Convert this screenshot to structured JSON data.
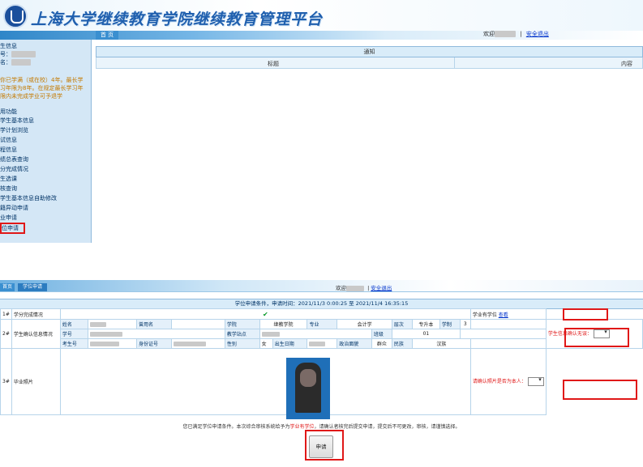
{
  "top": {
    "site_title": "上海大学继续教育学院继续教育管理平台",
    "home_tab": "首 页",
    "welcome": "欢迎",
    "separator": "|",
    "logout": "安全退出",
    "sidebar": {
      "student_info_header": "生信息",
      "student_no_label": "号：",
      "name_label": "名：",
      "notice_lines": [
        "你已学满（或在校）4年。最长学",
        "习年限为8年。在规定最长学习年",
        "限内未完成学业可予退学"
      ],
      "func_header": "用功能",
      "items": [
        "学生基本信息",
        "学计划浏览",
        "试信息",
        "程信息",
        "绩总表查询",
        "分完成情况",
        "生选课",
        "核查询",
        "学生基本信息自助修改",
        "籍异动申请",
        "业申请",
        "位申请"
      ]
    },
    "notice": {
      "title": "通知",
      "col_title": "标题",
      "col_content": "内容"
    }
  },
  "bottom": {
    "tabs": [
      "首页",
      "学位申请"
    ],
    "welcome": "欢迎",
    "logout": "安全退出",
    "condition_bar": "学位申请条件，申请时间：2021/11/3 0:00:25 至 2021/11/4 16:35:15",
    "rows": {
      "r1_num": "1#",
      "r1_label": "学分完成情况",
      "r1_check": "✔",
      "r1_right": "学业有学位",
      "r1_right_link": "查看",
      "r2_num": "2#",
      "r2_label": "学生确认信息情况",
      "r2_right": "学生信息确认无误：",
      "r3_num": "3#",
      "r3_label": "毕业照片",
      "r3_right": "请确认照片是否为本人："
    },
    "info": {
      "name_label": "姓名",
      "alias_label": "曾用名",
      "college_label": "学院",
      "college_value": "继教学院",
      "major_label": "专业",
      "major_value": "会计学",
      "level_label": "层次",
      "level_value": "专升本",
      "system_label": "学制",
      "system_value": "3",
      "stuno_label": "学号",
      "station_label": "教学站点",
      "class_label": "班级",
      "class_value": "01",
      "examno_label": "考生号",
      "id_label": "身份证号",
      "sex_label": "性别",
      "sex_value": "女",
      "birth_label": "出生日期",
      "politic_label": "政治面貌",
      "politic_value": "群众",
      "nation_label": "民族",
      "nation_value": "汉族"
    },
    "footer_pre": "您已满足学位申请条件。本次综合审核系统给予为",
    "footer_red": "学业有学位",
    "footer_post": "，请确认者核完后提交申请，提交后不可更改，审核，请谨慎选择。",
    "apply_button": "申请"
  }
}
